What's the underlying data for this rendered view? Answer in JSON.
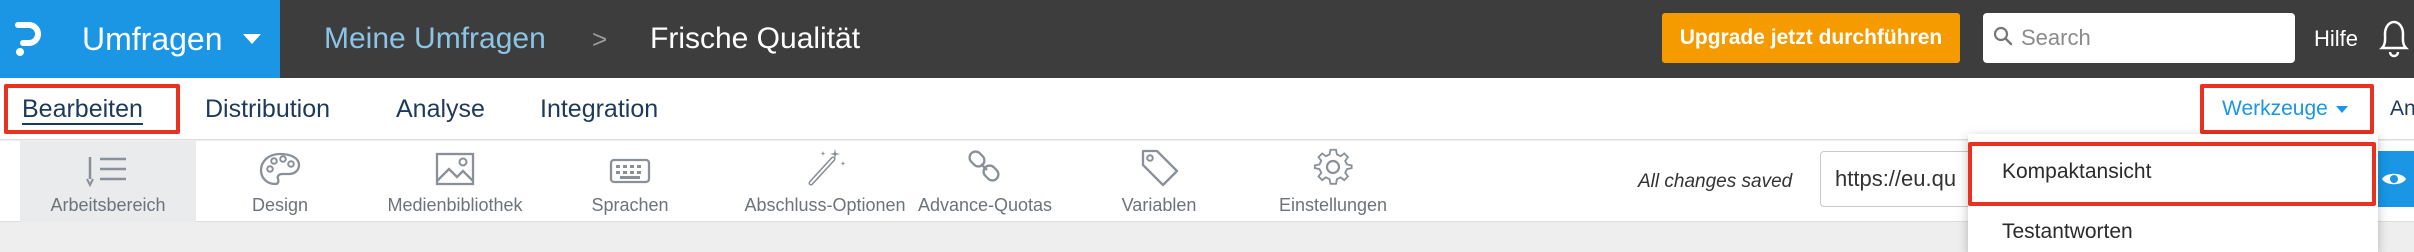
{
  "header": {
    "app_name": "Umfragen",
    "breadcrumb_parent": "Meine Umfragen",
    "breadcrumb_separator": ">",
    "survey_title": "Frische Qualität",
    "upgrade_label": "Upgrade jetzt durchführen",
    "search_placeholder": "Search",
    "help_label": "Hilfe"
  },
  "nav": {
    "tabs": [
      {
        "label": "Bearbeiten"
      },
      {
        "label": "Distribution"
      },
      {
        "label": "Analyse"
      },
      {
        "label": "Integration"
      }
    ],
    "tools_label": "Werkzeuge",
    "extra_label": "An"
  },
  "toolbar": {
    "items": [
      {
        "label": "Arbeitsbereich",
        "icon": "list-icon"
      },
      {
        "label": "Design",
        "icon": "palette-icon"
      },
      {
        "label": "Medienbibliothek",
        "icon": "image-icon"
      },
      {
        "label": "Sprachen",
        "icon": "keyboard-icon"
      },
      {
        "label": "Abschluss-Optionen",
        "icon": "magic-wand-icon"
      },
      {
        "label": "Advance-Quotas",
        "icon": "chain-link-icon"
      },
      {
        "label": "Variablen",
        "icon": "tag-icon"
      },
      {
        "label": "Einstellungen",
        "icon": "gear-icon"
      }
    ],
    "saved_status": "All changes saved",
    "survey_url": "https://eu.qu"
  },
  "tools_menu": {
    "items": [
      {
        "label": "Kompaktansicht"
      },
      {
        "label": "Testantworten"
      }
    ]
  },
  "colors": {
    "brand_blue": "#1a96e4",
    "topbar": "#3d3d3d",
    "upgrade_orange": "#f59b00",
    "highlight_red": "#e8311f"
  }
}
